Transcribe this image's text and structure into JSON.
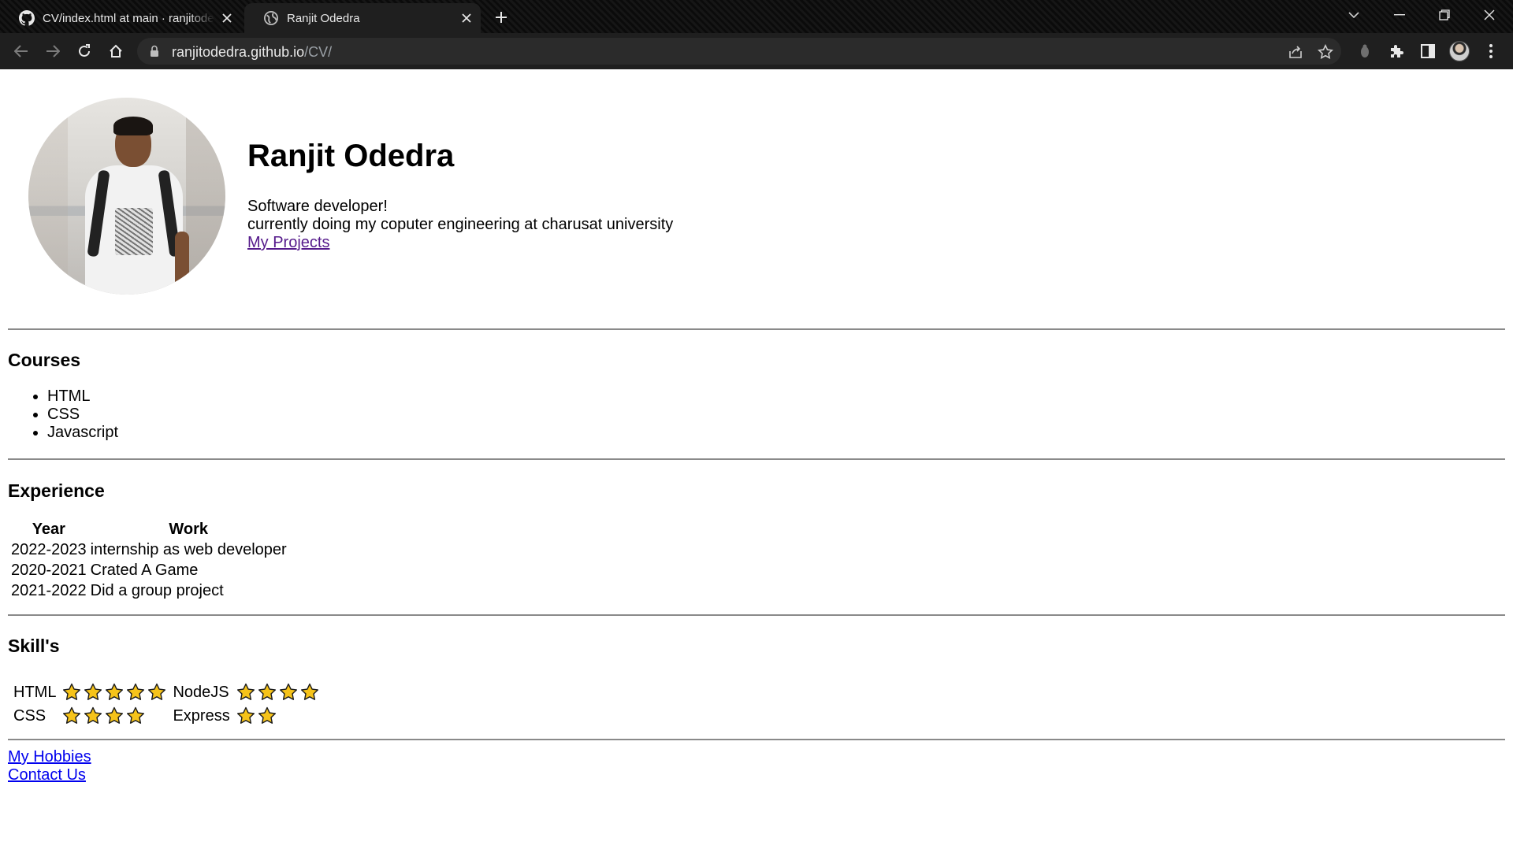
{
  "browser": {
    "tabs": [
      {
        "title": "CV/index.html at main · ranjitodedra/CV",
        "icon": "github-icon",
        "active": false
      },
      {
        "title": "Ranjit Odedra",
        "icon": "globe-icon",
        "active": true
      }
    ],
    "url_host": "ranjitodedra.github.io",
    "url_path": "/CV/"
  },
  "profile": {
    "name": "Ranjit Odedra",
    "tagline_1": "Software developer!",
    "tagline_2": "currently doing my coputer engineering at charusat university",
    "projects_link": "My Projects"
  },
  "courses": {
    "heading": "Courses",
    "items": [
      "HTML",
      "CSS",
      "Javascript"
    ]
  },
  "experience": {
    "heading": "Experience",
    "columns": [
      "Year",
      "Work"
    ],
    "rows": [
      {
        "year": "2022-2023",
        "work": "internship as web developer"
      },
      {
        "year": "2020-2021",
        "work": "Crated A Game"
      },
      {
        "year": "2021-2022",
        "work": "Did a group project"
      }
    ]
  },
  "skills": {
    "heading": "Skill's",
    "items": [
      {
        "name": "HTML",
        "stars": 5
      },
      {
        "name": "NodeJS",
        "stars": 4
      },
      {
        "name": "CSS",
        "stars": 4
      },
      {
        "name": "Express",
        "stars": 2
      }
    ]
  },
  "footer_links": {
    "hobbies": "My Hobbies",
    "contact": "Contact Us"
  },
  "colors": {
    "star_fill": "#f6c319",
    "star_stroke": "#1a1a1a",
    "visited_link": "#551a8b",
    "link": "#0000ee"
  }
}
